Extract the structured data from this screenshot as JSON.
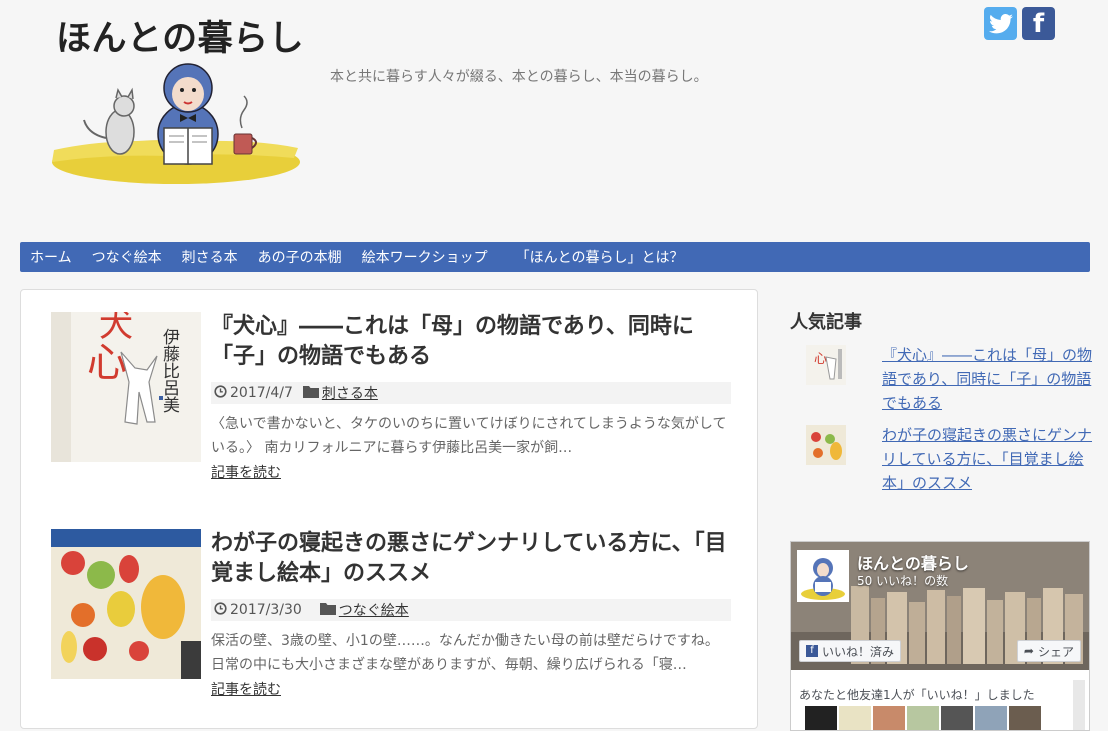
{
  "site": {
    "title": "ほんとの暮らし",
    "tagline": "本と共に暮らす人々が綴る、本との暮らし、本当の暮らし。"
  },
  "social": {
    "twitter_icon": "twitter-icon",
    "facebook_icon": "facebook-icon",
    "facebook_glyph": "f"
  },
  "nav": {
    "items": [
      {
        "label": "ホーム"
      },
      {
        "label": "つなぐ絵本"
      },
      {
        "label": "刺さる本"
      },
      {
        "label": "あの子の本棚"
      },
      {
        "label": "絵本ワークショップ"
      },
      {
        "label": "「ほんとの暮らし」とは？"
      }
    ],
    "color": "#4169b5"
  },
  "posts": [
    {
      "title": "『犬心』――これは「母」の物語であり、同時に「子」の物語でもある",
      "date": "2017/4/7",
      "category": "刺さる本",
      "excerpt": "〈急いで書かないと、タケのいのちに置いてけぼりにされてしまうような気がしている。〉 南カリフォルニアに暮らす伊藤比呂美一家が飼…",
      "read_more": "記事を読む"
    },
    {
      "title": "わが子の寝起きの悪さにゲンナリしている方に、「目覚まし絵本」のススメ",
      "date": "2017/3/30",
      "category": "つなぐ絵本",
      "excerpt": "保活の壁、3歳の壁、小1の壁……。なんだか働きたい母の前は壁だらけですね。日常の中にも大小さまざまな壁がありますが、毎朝、繰り広げられる「寝…",
      "read_more": "記事を読む"
    }
  ],
  "book_cover": {
    "title_glyph": "犬",
    "title_glyph2": "心",
    "author": "伊藤比呂美"
  },
  "sidebar": {
    "popular_title": "人気記事",
    "popular": [
      {
        "title": "『犬心』――これは「母」の物語であり、同時に「子」の物語でもある"
      },
      {
        "title": "わが子の寝起きの悪さにゲンナリしている方に、「目覚まし絵本」のススメ"
      }
    ],
    "link_color": "#4169b5"
  },
  "fb_widget": {
    "page_name": "ほんとの暮らし",
    "likes": "50 いいね！の数",
    "like_button": "いいね！済み",
    "share_button": "シェア",
    "friends_text": "あなたと他友達1人が「いいね！」しました"
  }
}
